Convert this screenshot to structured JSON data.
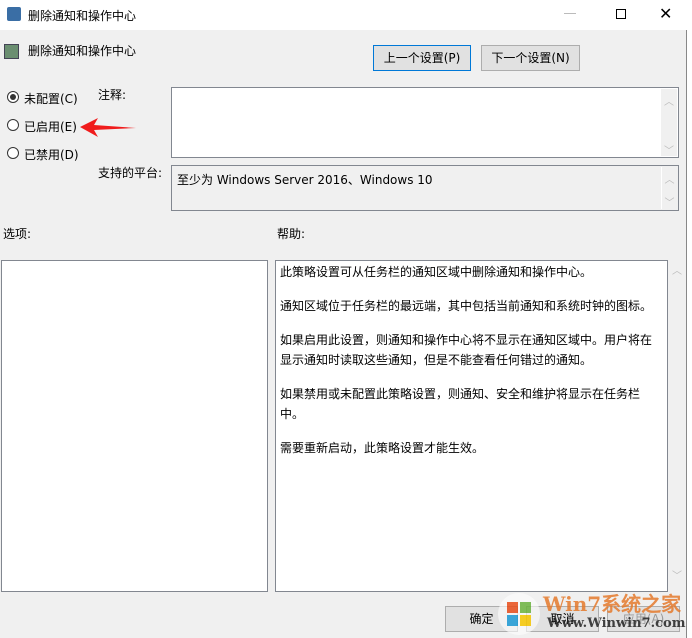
{
  "window": {
    "title": "删除通知和操作中心"
  },
  "header": {
    "title": "删除通知和操作中心",
    "prev_label": "上一个设置(P)",
    "next_label": "下一个设置(N)"
  },
  "state": {
    "options": [
      {
        "label": "未配置(C)",
        "selected": true
      },
      {
        "label": "已启用(E)",
        "selected": false
      },
      {
        "label": "已禁用(D)",
        "selected": false
      }
    ]
  },
  "comment": {
    "label": "注释:",
    "value": ""
  },
  "platform": {
    "label": "支持的平台:",
    "value": "至少为 Windows Server 2016、Windows 10"
  },
  "options_label": "选项:",
  "help": {
    "label": "帮助:",
    "paragraphs": [
      "此策略设置可从任务栏的通知区域中删除通知和操作中心。",
      "通知区域位于任务栏的最远端，其中包括当前通知和系统时钟的图标。",
      "如果启用此设置，则通知和操作中心将不显示在通知区域中。用户将在显示通知时读取这些通知，但是不能查看任何错过的通知。",
      "如果禁用或未配置此策略设置，则通知、安全和维护将显示在任务栏中。",
      "需要重新启动，此策略设置才能生效。"
    ]
  },
  "footer": {
    "ok_label": "确定",
    "cancel_label": "取消",
    "apply_label": "应用(A)"
  },
  "watermark": {
    "title": "Win7系统之家",
    "url": "Www.Winwin7.com"
  }
}
